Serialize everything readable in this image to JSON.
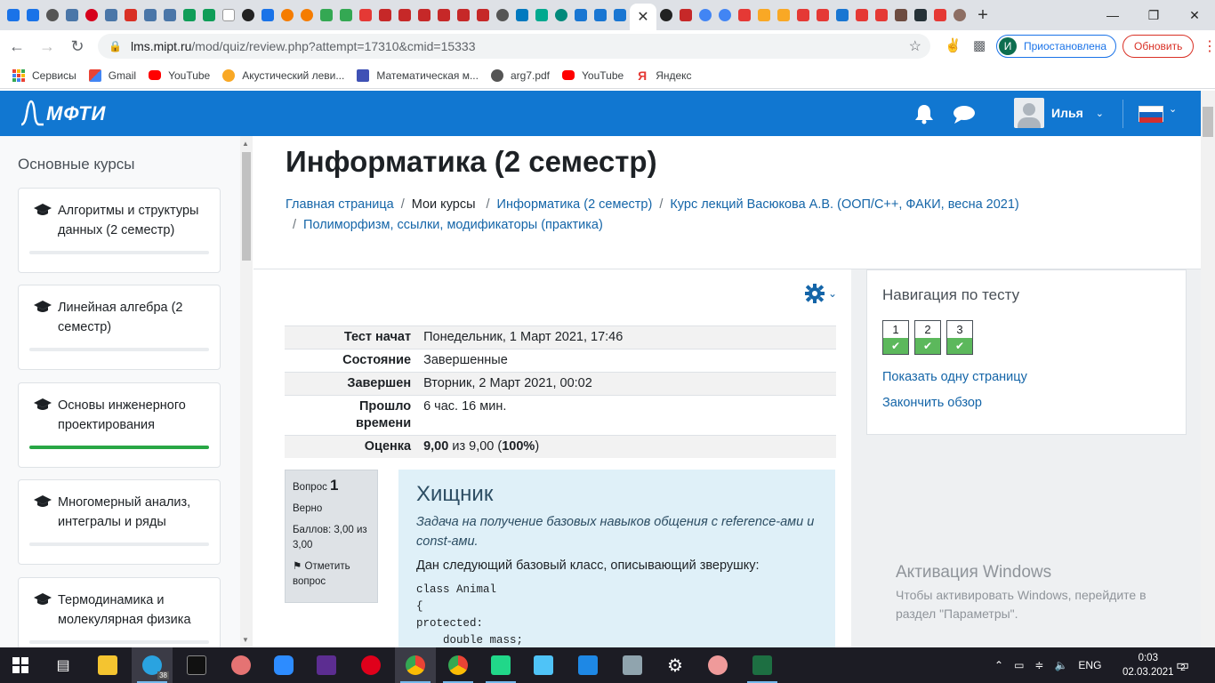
{
  "browser": {
    "tab_close": "✕",
    "new_tab": "+",
    "url_host": "lms.mipt.ru",
    "url_path": "/mod/quiz/review.php?attempt=17310&cmid=15333",
    "profile_initial": "И",
    "profile_status": "Приостановлена",
    "update_label": "Обновить",
    "bookmarks": [
      {
        "label": "Сервисы",
        "icon": "apps-icon"
      },
      {
        "label": "Gmail",
        "icon": "gmail-icon"
      },
      {
        "label": "YouTube",
        "icon": "youtube-icon"
      },
      {
        "label": "Акустический леви...",
        "icon": "bookmark-icon"
      },
      {
        "label": "Математическая м...",
        "icon": "bookmark-icon"
      },
      {
        "label": "arg7.pdf",
        "icon": "globe-icon"
      },
      {
        "label": "YouTube",
        "icon": "youtube-icon"
      },
      {
        "label": "Яндекс",
        "icon": "yandex-icon"
      }
    ]
  },
  "site": {
    "logo": "МФТИ",
    "user_name": "Илья"
  },
  "drawer": {
    "heading": "Основные курсы",
    "courses": [
      {
        "name": "Алгоритмы и структуры данных (2 семестр)",
        "progress": 0
      },
      {
        "name": "Линейная алгебра (2 семестр)",
        "progress": 0
      },
      {
        "name": "Основы инженерного проектирования",
        "progress": 100
      },
      {
        "name": "Многомерный анализ, интегралы и ряды",
        "progress": 0
      },
      {
        "name": "Термодинамика и молекулярная физика",
        "progress": 0
      }
    ]
  },
  "page": {
    "title": "Информатика (2 семестр)",
    "breadcrumbs": [
      {
        "label": "Главная страница",
        "link": true
      },
      {
        "label": "Мои курсы",
        "link": false
      },
      {
        "label": "Информатика (2 семестр)",
        "link": true
      },
      {
        "label": "Курс лекций Васюкова А.В. (ООП/C++, ФАКИ, весна 2021)",
        "link": true
      },
      {
        "label": "Полиморфизм, ссылки, модификаторы (практика)",
        "link": true
      }
    ]
  },
  "summary": {
    "started_label": "Тест начат",
    "started_value": "Понедельник, 1 Март 2021, 17:46",
    "state_label": "Состояние",
    "state_value": "Завершенные",
    "finished_label": "Завершен",
    "finished_value": "Вторник, 2 Март 2021, 00:02",
    "elapsed_label": "Прошло времени",
    "elapsed_value": "6 час. 16 мин.",
    "grade_label": "Оценка",
    "grade_bold": "9,00",
    "grade_mid": " из 9,00 (",
    "grade_pct": "100%",
    "grade_end": ")"
  },
  "question": {
    "no_label": "Вопрос",
    "no": "1",
    "status": "Верно",
    "marks": "Баллов: 3,00 из 3,00",
    "flag": "Отметить вопрос",
    "title": "Хищник",
    "intro": "Задача на получение базовых навыков общения с reference-ами и const-ами.",
    "lead": "Дан следующий базовый класс, описывающий зверушку:",
    "code": "class Animal\n{\nprotected:\n    double mass;"
  },
  "quiznav": {
    "heading": "Навигация по тесту",
    "buttons": [
      "1",
      "2",
      "3"
    ],
    "show_one_page": "Показать одну страницу",
    "finish_review": "Закончить обзор"
  },
  "watermark": {
    "line1": "Активация Windows",
    "line2": "Чтобы активировать Windows, перейдите в раздел \"Параметры\"."
  },
  "taskbar": {
    "lang": "ENG",
    "time": "0:03",
    "date": "02.03.2021",
    "notif_count": "2",
    "telegram_badge": "38"
  },
  "colors": {
    "site_nav": "#1177d1",
    "link": "#1465a8",
    "success": "#5cb85c",
    "progress": "#28a745"
  }
}
